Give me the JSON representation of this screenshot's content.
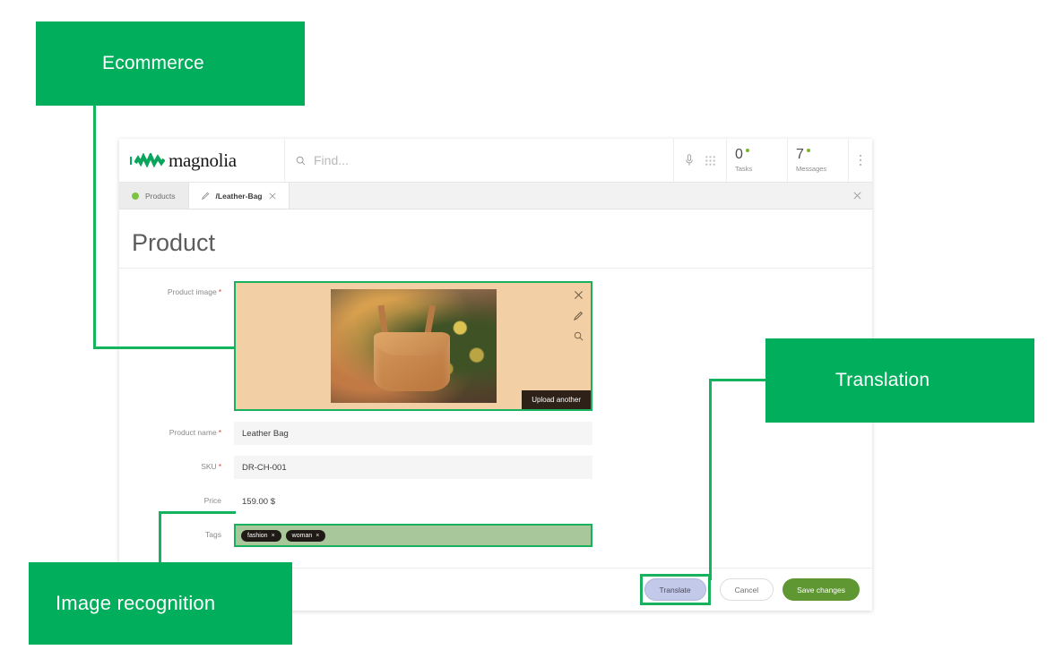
{
  "annotations": [
    {
      "id": "ecommerce",
      "label": "Ecommerce"
    },
    {
      "id": "translation",
      "label": "Translation"
    },
    {
      "id": "image_recognition",
      "label": "Image recognition"
    }
  ],
  "colors": {
    "callout_green": "#00ae5c",
    "highlight_green": "#19b05e",
    "save_green": "#5f9733",
    "translate_focus": "#c3c9e8",
    "tag_field_green": "#a8c79a",
    "image_field_bg": "#f2cfa4",
    "required_red": "#e0452f",
    "status_dot_green": "#7db32f"
  },
  "app": {
    "brand": {
      "name": "magnolia",
      "logo_icon": "magnolia-wave-logo"
    },
    "search": {
      "value": "",
      "placeholder": "Find...",
      "icon": "search-icon"
    },
    "header_icons": [
      {
        "name": "microphone-icon",
        "glyph": "mic"
      },
      {
        "name": "apps-grid-icon",
        "glyph": "grid"
      }
    ],
    "header_counters": [
      {
        "name": "tasks",
        "count": "0",
        "caption": "Tasks"
      },
      {
        "name": "messages",
        "count": "7",
        "caption": "Messages"
      }
    ],
    "header_more_icon": "vertical-dots-icon",
    "tabs": [
      {
        "id": "products",
        "label": "Products",
        "active": false,
        "icon": "status-dot"
      },
      {
        "id": "leather-bag",
        "label": "/Leather-Bag",
        "active": true,
        "icon": "pencil-icon",
        "close_icon": "close-icon"
      }
    ],
    "tab_bar_close_icon": "close-icon",
    "page_title": "Product",
    "form": {
      "fields": [
        {
          "id": "product_image",
          "label": "Product image",
          "required": true,
          "type": "image",
          "highlighted": true
        },
        {
          "id": "product_name",
          "label": "Product name",
          "required": true,
          "type": "text",
          "value": "Leather Bag"
        },
        {
          "id": "sku",
          "label": "SKU",
          "required": true,
          "type": "text",
          "value": "DR-CH-001"
        },
        {
          "id": "price",
          "label": "Price",
          "required": false,
          "type": "plain",
          "value": "159.00 $"
        },
        {
          "id": "tags",
          "label": "Tags",
          "required": false,
          "type": "chips",
          "highlighted": true
        }
      ],
      "image_field": {
        "actions": [
          {
            "name": "remove-image-icon",
            "glyph": "×"
          },
          {
            "name": "edit-image-icon",
            "glyph": "pencil"
          },
          {
            "name": "preview-image-icon",
            "glyph": "magnifier"
          }
        ],
        "upload_button": "Upload another",
        "alt": "Woman wearing a tan leather backpack outdoors"
      },
      "tags": [
        {
          "label": "fashion",
          "remove": "×"
        },
        {
          "label": "woman",
          "remove": "×"
        }
      ]
    },
    "footer_buttons": [
      {
        "id": "translate",
        "label": "Translate",
        "highlighted": true
      },
      {
        "id": "cancel",
        "label": "Cancel",
        "highlighted": false
      },
      {
        "id": "save",
        "label": "Save changes",
        "highlighted": false
      }
    ]
  }
}
